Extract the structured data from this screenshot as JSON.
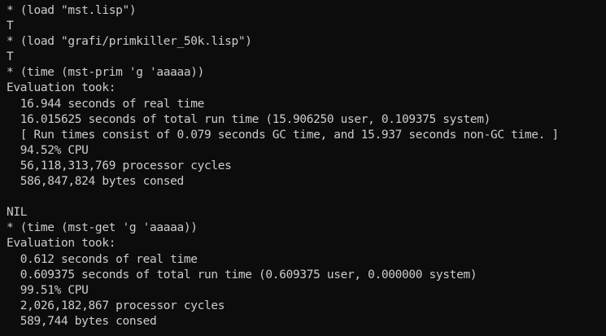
{
  "terminal": {
    "lines": [
      "* (load \"mst.lisp\")",
      "T",
      "* (load \"grafi/primkiller_50k.lisp\")",
      "T",
      "* (time (mst-prim 'g 'aaaaa))",
      "Evaluation took:",
      "  16.944 seconds of real time",
      "  16.015625 seconds of total run time (15.906250 user, 0.109375 system)",
      "  [ Run times consist of 0.079 seconds GC time, and 15.937 seconds non-GC time. ]",
      "  94.52% CPU",
      "  56,118,313,769 processor cycles",
      "  586,847,824 bytes consed",
      "",
      "NIL",
      "* (time (mst-get 'g 'aaaaa))",
      "Evaluation took:",
      "  0.612 seconds of real time",
      "  0.609375 seconds of total run time (0.609375 user, 0.000000 system)",
      "  99.51% CPU",
      "  2,026,182,867 processor cycles",
      "  589,744 bytes consed"
    ]
  },
  "colors": {
    "background": "#0c0c0c",
    "foreground": "#cccccc"
  }
}
